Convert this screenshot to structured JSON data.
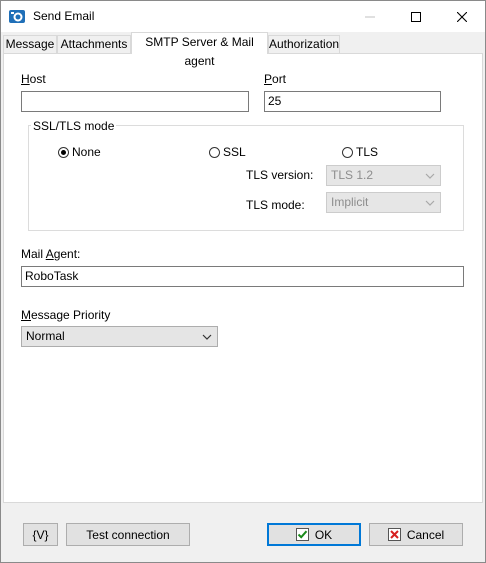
{
  "window": {
    "title": "Send Email"
  },
  "tabs": [
    {
      "label": "Message"
    },
    {
      "label": "Attachments"
    },
    {
      "label": "SMTP Server & Mail agent"
    },
    {
      "label": "Authorization"
    }
  ],
  "active_tab": "SMTP Server & Mail agent",
  "host": {
    "label_u": "H",
    "label_rest": "ost",
    "value": ""
  },
  "port": {
    "label_u": "P",
    "label_rest": "ort",
    "value": "25"
  },
  "ssl_tls": {
    "title": "SSL/TLS mode",
    "options": [
      {
        "label": "None",
        "selected": true
      },
      {
        "label": "SSL",
        "selected": false
      },
      {
        "label": "TLS",
        "selected": false
      }
    ],
    "tls_version": {
      "label": "TLS version:",
      "value": "TLS 1.2",
      "enabled": false
    },
    "tls_mode": {
      "label": "TLS mode:",
      "value": "Implicit",
      "enabled": false
    }
  },
  "mail_agent": {
    "label_pre": "Mail ",
    "label_u": "A",
    "label_rest": "gent:",
    "value": "RoboTask"
  },
  "priority": {
    "label_pre": "",
    "label_u": "M",
    "label_rest": "essage Priority",
    "value": "Normal"
  },
  "buttons": {
    "vars": "{V}",
    "test": "Test connection",
    "ok": "OK",
    "cancel": "Cancel"
  },
  "colors": {
    "accent": "#0078d7",
    "ok_check": "#1a8a1a",
    "cancel_x": "#d62020"
  }
}
